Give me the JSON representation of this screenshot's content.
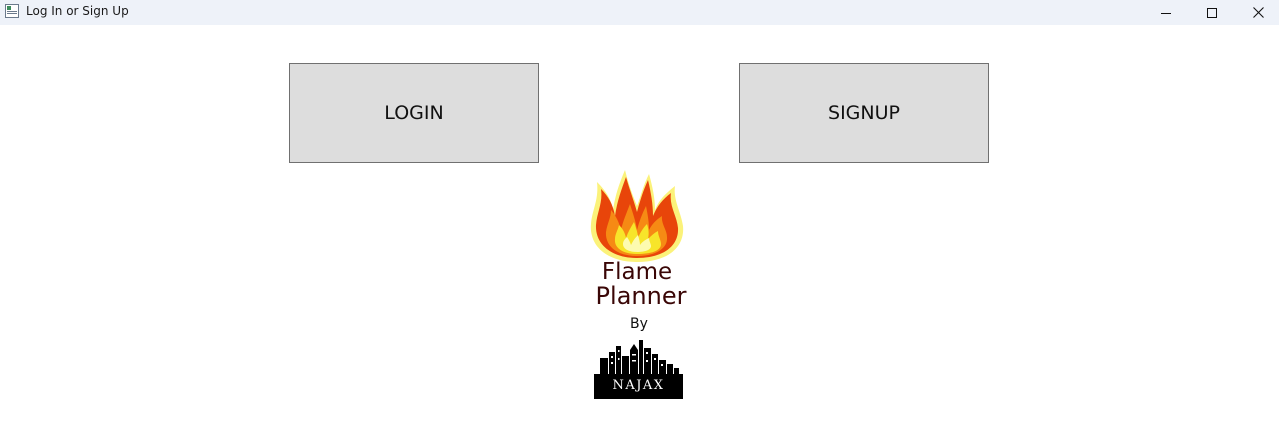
{
  "window": {
    "title": "Log In or Sign Up",
    "controls": {
      "minimize_icon": "minimize-icon",
      "maximize_icon": "maximize-icon",
      "close_icon": "close-icon"
    }
  },
  "main": {
    "login_label": "LOGIN",
    "signup_label": "SIGNUP"
  },
  "logo": {
    "name_line1": "Flame",
    "name_line2": "Planner",
    "by_text": "By",
    "company": "NAJAX"
  },
  "colors": {
    "titlebar_bg": "#eef2f9",
    "button_bg": "#dddddd",
    "button_border": "#707070",
    "logo_text": "#3a0606",
    "flame_outer": "#e8450a",
    "flame_inner": "#f7e52a"
  }
}
